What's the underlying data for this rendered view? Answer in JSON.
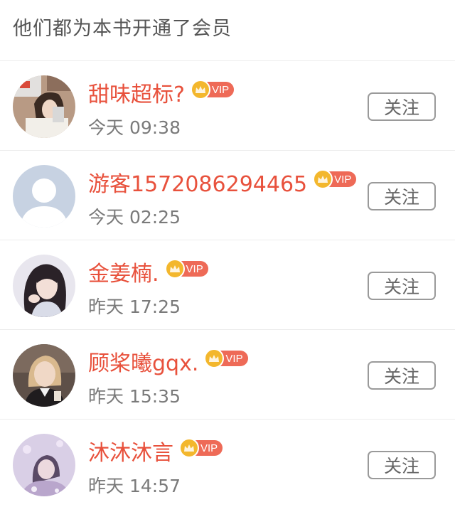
{
  "header": {
    "title": "他们都为本书开通了会员"
  },
  "vip_label": "VIP",
  "follow_label": "关注",
  "colors": {
    "username": "#e8513c",
    "vip_pill": "#ee6a57",
    "crown": "#f3b72d",
    "time": "#7a7a7a"
  },
  "members": [
    {
      "name": "甜味超标?",
      "time": "今天 09:38",
      "avatar": "photo-avatar"
    },
    {
      "name": "游客1572086294465",
      "time": "今天 02:25",
      "avatar": "default-user-avatar"
    },
    {
      "name": "金姜楠.",
      "time": "昨天 17:25",
      "avatar": "photo-avatar"
    },
    {
      "name": "顾桨曦gqx.",
      "time": "昨天 15:35",
      "avatar": "photo-avatar"
    },
    {
      "name": "沐沐沐言",
      "time": "昨天 14:57",
      "avatar": "photo-avatar"
    }
  ]
}
